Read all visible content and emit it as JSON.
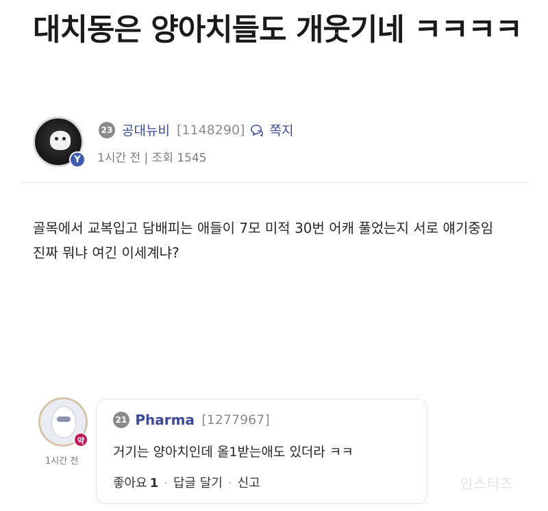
{
  "post": {
    "title": "대치동은 양아치들도 개웃기네 ㅋㅋㅋㅋ",
    "author": {
      "level": "23",
      "name": "공대뉴비",
      "id": "[1148290]",
      "message_label": "쪽지",
      "badge": "Y"
    },
    "meta": "1시간 전 | 조회 1545",
    "body": "골목에서 교복입고 담배피는 애들이 7모 미적 30번 어캐 풀었는지 서로 얘기중임 진짜 뭐냐 여긴 이세계냐?"
  },
  "comment": {
    "level": "21",
    "name": "Pharma",
    "id": "[1277967]",
    "badge": "약",
    "time": "1시간 전",
    "text": "거기는 양아치인데 올1받는애도 있더라 ㅋㅋ",
    "like_label": "좋아요",
    "like_count": "1",
    "reply_label": "답글 달기",
    "report_label": "신고"
  },
  "watermark": "인스티즈"
}
